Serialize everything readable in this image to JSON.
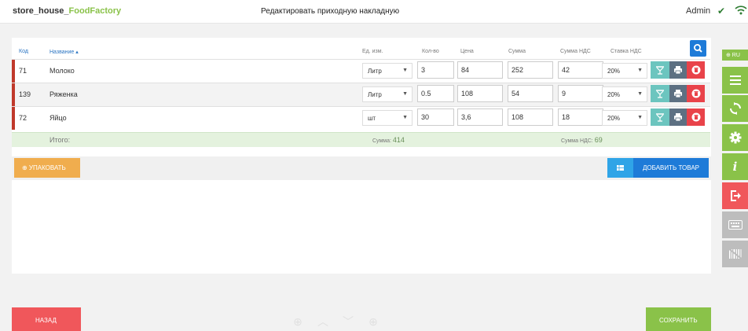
{
  "header": {
    "brand_prefix": "store_house_",
    "brand_suffix": "FoodFactory",
    "title": "Редактировать приходную накладную",
    "user": "Admin"
  },
  "table": {
    "columns": {
      "code": "Код",
      "name": "Название ▴",
      "unit": "Ед. изм.",
      "qty": "Кол-во",
      "price": "Цена",
      "sum": "Сумма",
      "vat_sum": "Сумма НДС",
      "vat_rate": "Ставка НДС"
    },
    "rows": [
      {
        "code": "71",
        "name": "Молоко",
        "unit": "Литр",
        "qty": "3",
        "price": "84",
        "sum": "252",
        "vat_sum": "42",
        "vat_rate": "20%"
      },
      {
        "code": "139",
        "name": "Ряженка",
        "unit": "Литр",
        "qty": "0.5",
        "price": "108",
        "sum": "54",
        "vat_sum": "9",
        "vat_rate": "20%"
      },
      {
        "code": "72",
        "name": "Яйцо",
        "unit": "шт",
        "qty": "30",
        "price": "3,6",
        "sum": "108",
        "vat_sum": "18",
        "vat_rate": "20%"
      }
    ],
    "totals": {
      "label": "Итого:",
      "sum_label": "Сумма:",
      "sum_value": "414",
      "vat_label": "Сумма НДС:",
      "vat_value": "69"
    }
  },
  "actions": {
    "pack": "⊕ УПАКОВАТЬ",
    "add_product": "ДОБАВИТЬ ТОВАР",
    "back": "НАЗАД",
    "save": "СОХРАНИТЬ"
  },
  "sidebar": {
    "lang": "⊕ RU"
  },
  "colors": {
    "accent_green": "#8ac249",
    "primary_blue": "#1e7bd8",
    "danger_red": "#f0575b",
    "warning_orange": "#f0ad4e"
  }
}
